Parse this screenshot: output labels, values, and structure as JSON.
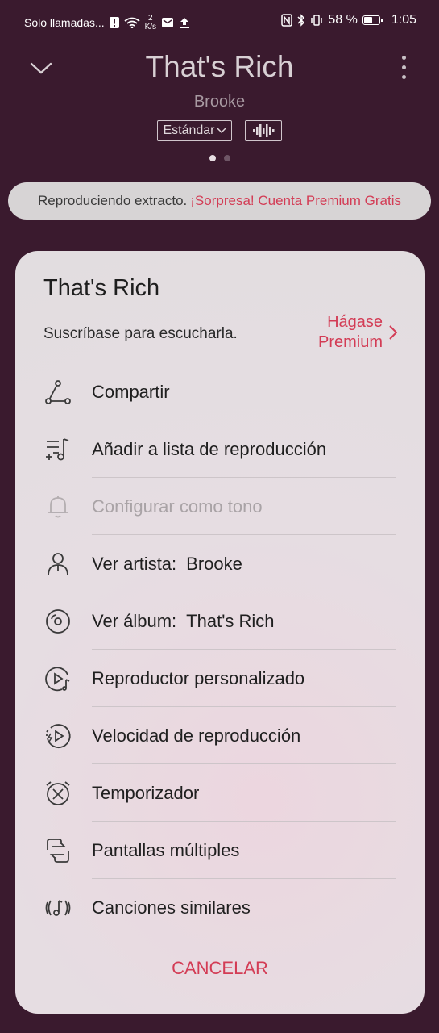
{
  "status_bar": {
    "carrier": "Solo llamadas...",
    "speed_value": "2",
    "speed_unit": "K/s",
    "battery_percent": "58 %",
    "battery_level": 0.58,
    "time": "1:05",
    "icons": [
      "alert-icon",
      "wifi-icon",
      "mail-icon",
      "upload-icon",
      "nfc-icon",
      "bluetooth-icon",
      "vibrate-icon",
      "battery-icon"
    ]
  },
  "player": {
    "title": "That's Rich",
    "artist": "Brooke",
    "quality_label": "Estándar",
    "page_count": 2,
    "active_page": 0
  },
  "banner": {
    "text": "Reproduciendo extracto.",
    "promo": "¡Sorpresa! Cuenta Premium Gratis"
  },
  "sheet": {
    "title": "That's Rich",
    "subscribe_text": "Suscríbase para escucharla.",
    "premium_line1": "Hágase",
    "premium_line2": "Premium",
    "menu": [
      {
        "label": "Compartir",
        "icon": "share-icon",
        "disabled": false
      },
      {
        "label": "Añadir a lista de reproducción",
        "icon": "add-playlist-icon",
        "disabled": false
      },
      {
        "label": "Configurar como tono",
        "icon": "bell-icon",
        "disabled": true
      },
      {
        "label": "Ver artista:",
        "value": "Brooke",
        "icon": "artist-icon",
        "disabled": false
      },
      {
        "label": "Ver álbum:",
        "value": "That's Rich",
        "icon": "album-icon",
        "disabled": false
      },
      {
        "label": "Reproductor personalizado",
        "icon": "custom-player-icon",
        "disabled": false
      },
      {
        "label": "Velocidad de reproducción",
        "icon": "playback-speed-icon",
        "disabled": false
      },
      {
        "label": "Temporizador",
        "icon": "timer-icon",
        "disabled": false
      },
      {
        "label": "Pantallas múltiples",
        "icon": "multi-screen-icon",
        "disabled": false
      },
      {
        "label": "Canciones similares",
        "icon": "similar-songs-icon",
        "disabled": false
      }
    ],
    "cancel_label": "CANCELAR"
  },
  "colors": {
    "background": "#3a1a2e",
    "accent": "#d33c55"
  }
}
